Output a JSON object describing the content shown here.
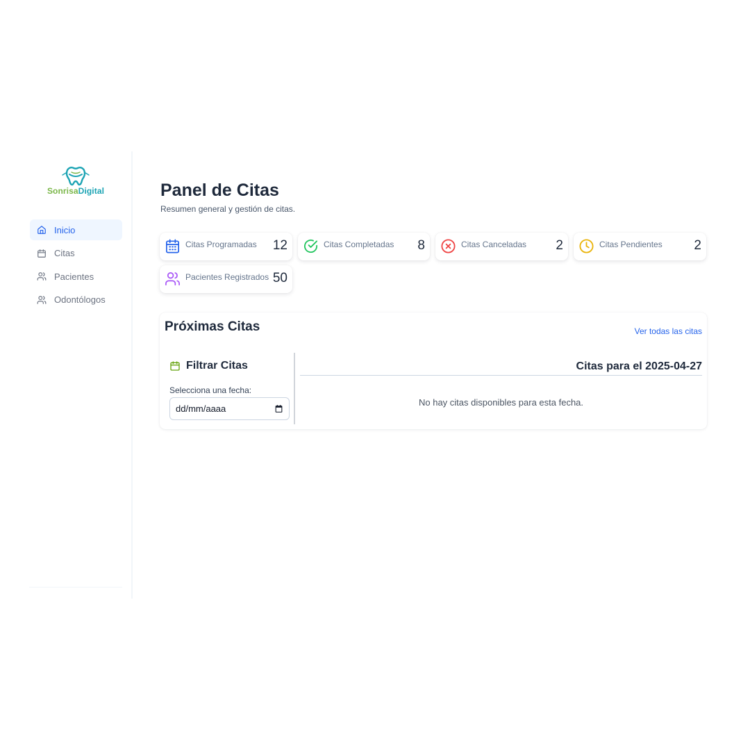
{
  "brand": {
    "part1": "Sonrisa",
    "part2": "Digital",
    "color1": "#7ab648",
    "color2": "#1ba3b3"
  },
  "sidebar": {
    "items": [
      {
        "label": "Inicio",
        "icon": "home-icon",
        "active": true
      },
      {
        "label": "Citas",
        "icon": "calendar-icon"
      },
      {
        "label": "Pacientes",
        "icon": "users-icon"
      },
      {
        "label": "Odontólogos",
        "icon": "users-icon"
      }
    ]
  },
  "header": {
    "title": "Panel de Citas",
    "subtitle": "Resumen general y gestión de citas."
  },
  "stats": [
    {
      "label": "Citas Programadas",
      "value": "12",
      "icon": "calendar-icon",
      "color": "#2563eb"
    },
    {
      "label": "Citas Completadas",
      "value": "8",
      "icon": "check-circle-icon",
      "color": "#22c55e"
    },
    {
      "label": "Citas Canceladas",
      "value": "2",
      "icon": "x-circle-icon",
      "color": "#ef4444"
    },
    {
      "label": "Citas Pendientes",
      "value": "2",
      "icon": "clock-icon",
      "color": "#eab308"
    },
    {
      "label": "Pacientes Registrados",
      "value": "50",
      "icon": "users-icon",
      "color": "#a855f7"
    }
  ],
  "upcoming": {
    "title": "Próximas Citas",
    "view_all": "Ver todas las citas",
    "filter": {
      "title": "Filtrar Citas",
      "icon": "calendar-icon",
      "icon_color": "#65a30d",
      "label": "Selecciona una fecha:",
      "placeholder": "dd/mm/aaaa"
    },
    "results_title": "Citas para el 2025-04-27",
    "empty_message": "No hay citas disponibles para esta fecha."
  },
  "colors": {
    "accent": "#2563eb",
    "active_bg": "#eff6ff",
    "text": "#1e293b"
  }
}
